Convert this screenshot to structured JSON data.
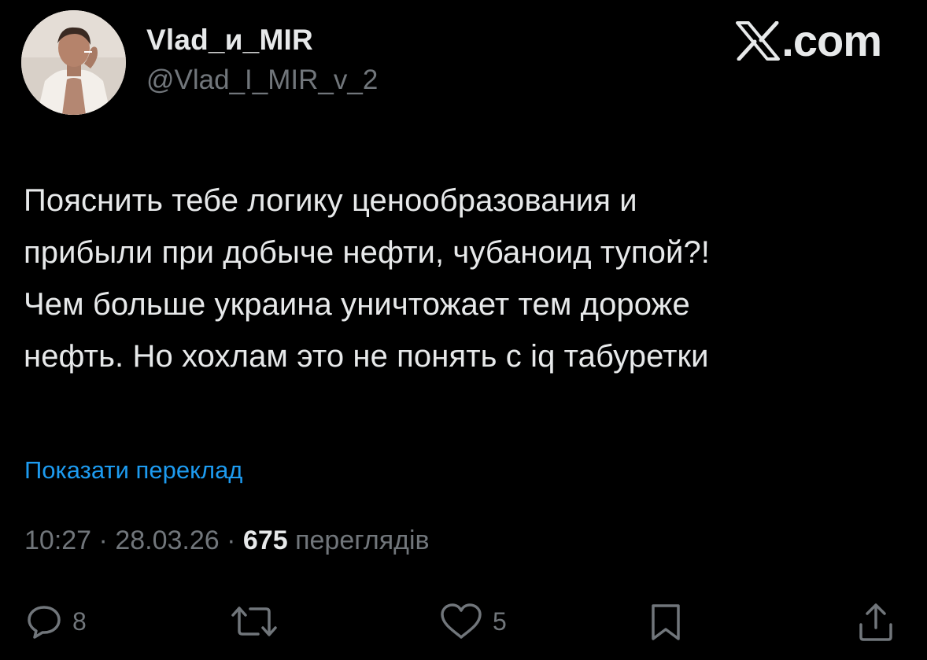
{
  "author": {
    "display_name": "Vlad_и_MIR",
    "handle": "@Vlad_I_MIR_v_2",
    "avatar_icon": "profile-photo"
  },
  "brand": {
    "label": ".com",
    "logo_icon": "x-logo-icon"
  },
  "tweet": {
    "text": "Пояснить тебе логику ценообразования и\nприбыли при добыче нефти, чубаноид тупой?!\nЧем больше украина уничтожает тем дороже\nнефть. Но хохлам это не понять с iq табуретки",
    "translate_label": "Показати переклад"
  },
  "meta": {
    "time": "10:27",
    "date": "28.03.26",
    "separator": "·",
    "views_count": "675",
    "views_label": "переглядів"
  },
  "actions": {
    "reply_count": "8",
    "like_count": "5"
  },
  "colors": {
    "background": "#000000",
    "text_primary": "#e7e9ea",
    "text_secondary": "#71767b",
    "link": "#1d9bf0"
  }
}
